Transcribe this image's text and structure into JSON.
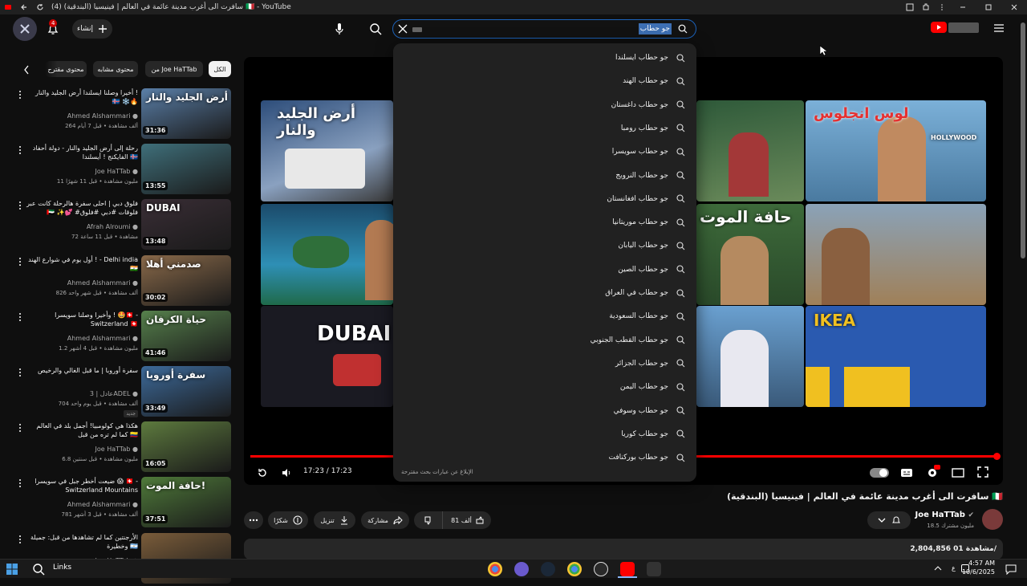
{
  "browser": {
    "window_title": "(4) سافرت الى أغرب مدينة عائمة في العالم | فينيسيا (البندقية) 🇮🇹 - YouTube"
  },
  "masthead": {
    "create_label": "إنشاء",
    "notification_count": "4",
    "search_value": "جو حطاب",
    "logo_label": "YouTube"
  },
  "suggestions": {
    "items": [
      "جو حطاب ايسلندا",
      "جو حطاب الهند",
      "جو حطاب داغستان",
      "جو حطاب رومبا",
      "جو حطاب سويسرا",
      "جو حطاب النرويج",
      "جو حطاب افغانستان",
      "جو حطاب موريتانيا",
      "جو حطاب اليابان",
      "جو حطاب الصين",
      "جو حطاب في العراق",
      "جو حطاب السعودية",
      "جو حطاب القطب الجنوبي",
      "جو حطاب الجزائر",
      "جو حطاب اليمن",
      "جو حطاب وسوفي",
      "جو حطاب كوريا",
      "جو حطاب بوركنافت"
    ],
    "footer": "الإبلاغ عن عبارات بحث مقترحة"
  },
  "player": {
    "time": "17:23 / 17:23",
    "end_screen_texts": [
      "أرض الجليد والنار",
      "DUBAI",
      "حافة الموت",
      "لوس انجلوس",
      "HOLLYWOOD",
      "IKEA"
    ]
  },
  "chips": {
    "all": "الكل",
    "from_channel": "من Joe HaTTab",
    "related": "محتوى مشابه",
    "suggested": "محتوى مقترح"
  },
  "related": [
    {
      "title": "أخيرا وصلنا ايسلندا أرض الجليد والنار ! 🇮🇸 ❄️🔥",
      "channel": "Ahmed Alshammari",
      "meta": "264 ألف مشاهدة • قبل 7 أيام",
      "duration": "31:36",
      "thumb_text": "أرض الجليد والنار",
      "thumb_color": "#5a7fa8"
    },
    {
      "title": "رحلة إلى أرض الجليد والنار - دولة أحفاد الفايكنج ! أيسلندا 🇮🇸",
      "channel": "Joe HaTTab",
      "meta": "11 مليون مشاهدة • قبل 11 شهرًا",
      "duration": "13:55",
      "thumb_text": "",
      "thumb_color": "#3f6f7a"
    },
    {
      "title": "فلوق دبي | احلى سفرة هالرحلة كانت عبر 🇦🇪 ✨💕 #فلوقات #دبي #فلوق",
      "channel": "Afrah Alroumi",
      "meta": "72 مشاهدة • قبل 11 ساعة",
      "duration": "13:48",
      "thumb_text": "DUBAI",
      "thumb_color": "#3a2e36"
    },
    {
      "title": "أول يوم في شوارع الهند ! - Delhi india 🇮🇳",
      "channel": "Ahmed Alshammari",
      "meta": "826 ألف مشاهدة • قبل شهر واحد",
      "duration": "30:02",
      "thumb_text": "صدمني أهلا",
      "thumb_color": "#8a6a4a"
    },
    {
      "title": "وأخيرا وصلنا سويسرا ! 🤩🇨🇭 - Switzerland 🇨🇭",
      "channel": "Ahmed Alshammari",
      "meta": "1.2 مليون مشاهدة • قبل 4 أشهر",
      "duration": "41:46",
      "thumb_text": "حياة الكرفان",
      "thumb_color": "#56804c"
    },
    {
      "title": "سفرة أوروبا | ما قبل الغالي والرخيص",
      "channel": "عادل | 3ADEL",
      "meta": "704 ألف مشاهدة • قبل يوم واحد",
      "duration": "33:49",
      "thumb_text": "سفرة أوروبا",
      "thumb_color": "#3d6a9a",
      "badge": "جديد"
    },
    {
      "title": "هكذا هي كولومبيا! أجمل بلد في العالم كما لم تره من قبل 🇨🇴",
      "channel": "Joe HaTTab",
      "meta": "6.8 مليون مشاهدة • قبل سنتين",
      "duration": "16:05",
      "thumb_text": "",
      "thumb_color": "#5d7a3e"
    },
    {
      "title": "ضيعت أخطر جبل في سويسرا 😱 🇨🇭 - Switzerland Mountains",
      "channel": "Ahmed Alshammari",
      "meta": "781 ألف مشاهدة • قبل 3 أشهر",
      "duration": "37:51",
      "thumb_text": "حافة الموت!",
      "thumb_color": "#4f7a3a"
    },
    {
      "title": "الأرجنتين كما لم تشاهدها من قبل: جميلة وخطيرة 🇦🇷",
      "channel": "Joe HaTTab",
      "meta": "",
      "duration": "",
      "thumb_text": "",
      "thumb_color": "#7a5c3a"
    }
  ],
  "video": {
    "title": "سافرت الى أغرب مدينة عائمة في العالم | فينيسيا (البندقية) 🇮🇹",
    "channel": "Joe HaTTab",
    "subscribers": "18.5 مليون مشترك",
    "likes": "81 ألف",
    "share": "مشاركة",
    "download": "تنزيل",
    "thanks": "شكرًا",
    "views": "2,804,856 مشاهدة",
    "date_fragment": "01/"
  },
  "taskbar": {
    "search_label": "Links",
    "time": "4:57 AM",
    "date": "10/6/2025",
    "lang": "ع"
  },
  "colors": {
    "accent_red": "#ff0000",
    "search_focus": "#1c62b9",
    "background": "#0f0f0f",
    "chip_bg": "#272727"
  }
}
